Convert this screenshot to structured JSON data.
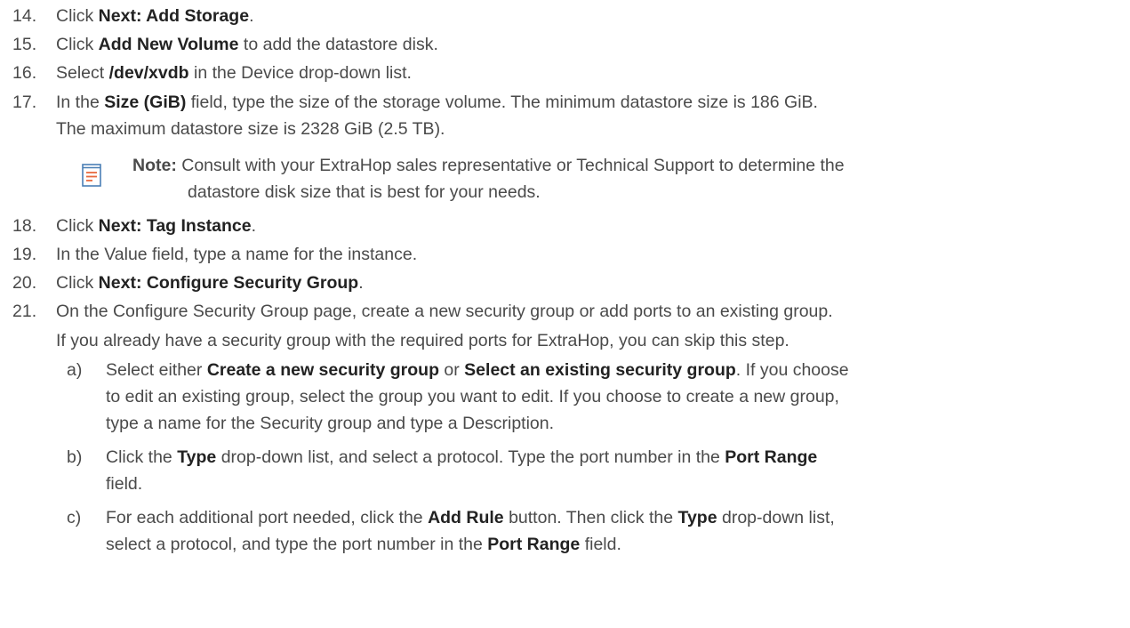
{
  "steps": [
    {
      "num": "14.",
      "pre": "Click ",
      "bold": "Next: Add Storage",
      "post": "."
    },
    {
      "num": "15.",
      "pre": "Click ",
      "bold": "Add New Volume",
      "post": " to add the datastore disk."
    },
    {
      "num": "16.",
      "pre": "Select ",
      "bold": "/dev/xvdb",
      "post": " in the Device drop-down list."
    },
    {
      "num": "17.",
      "pre": "In the ",
      "bold": "Size (GiB)",
      "post": " field, type the size of the storage volume. The minimum datastore size is 186 GiB.",
      "line2": "The maximum datastore size is 2328 GiB (2.5 TB)."
    },
    {
      "num": "18.",
      "pre": "Click ",
      "bold": "Next: Tag Instance",
      "post": "."
    },
    {
      "num": "19.",
      "text": "In the Value field, type a name for the instance."
    },
    {
      "num": "20.",
      "pre": "Click ",
      "bold": "Next: Configure Security Group",
      "post": "."
    },
    {
      "num": "21.",
      "text": "On the Configure Security Group page, create a new security group or add ports to an existing group.",
      "line2": "If you already have a security group with the required ports for ExtraHop, you can skip this step."
    }
  ],
  "note": {
    "label": "Note:",
    "line1": " Consult with your ExtraHop sales representative or Technical Support to determine the",
    "line2": "datastore disk size that is best for your needs.",
    "icon": "note-icon",
    "icon_color": "#e8693f"
  },
  "substeps": [
    {
      "label": "a)",
      "l1_a": "Select either ",
      "l1_b1": "Create a new security group",
      "l1_c": " or ",
      "l1_b2": "Select an existing security group",
      "l1_d": ". If you choose",
      "line2": "to edit an existing group, select the group you want to edit. If you choose to create a new group,",
      "line3": "type a name for the Security group and type a Description."
    },
    {
      "label": "b)",
      "l1_a": "Click the ",
      "l1_b1": "Type",
      "l1_c": " drop-down list, and select a protocol. Type the port number in the ",
      "l1_b2": "Port Range",
      "line2": "field."
    },
    {
      "label": "c)",
      "l1_a": "For each additional port needed, click the ",
      "l1_b1": "Add Rule",
      "l1_c": " button. Then click the ",
      "l1_b2": "Type",
      "l1_d": " drop-down list,",
      "l2_a": "select a protocol, and type the port number in the ",
      "l2_b": "Port Range",
      "l2_c": " field."
    }
  ]
}
